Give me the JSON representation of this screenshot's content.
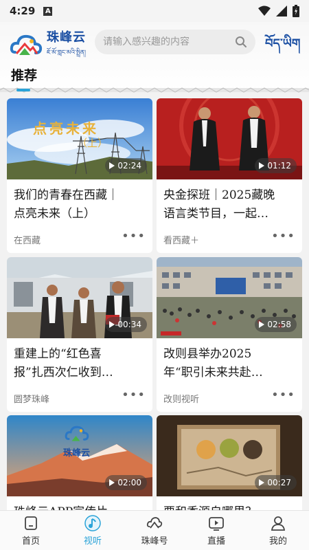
{
  "status_bar": {
    "time": "4:29",
    "badge": "A"
  },
  "header": {
    "logo_cn": "珠峰云",
    "logo_tib": "ཇོ་མོ་གླང་མའི་སྤྲིན།",
    "search_placeholder": "请输入感兴趣的内容",
    "lang_switch": "བོད་ཡིག",
    "page_title": "推荐"
  },
  "cards": [
    {
      "title_line1": "我们的青春在西藏｜",
      "title_line2": "点亮未来（上）",
      "source": "在西藏",
      "duration": "02:24",
      "overlay_text": "点亮未来",
      "overlay_sub": "（上）"
    },
    {
      "title_line1": "央金探班｜2025藏晚",
      "title_line2": "语言类节目，一起…",
      "source": "看西藏＋",
      "duration": "01:12"
    },
    {
      "title_line1": "重建上的“红色喜",
      "title_line2": "报”扎西次仁收到…",
      "source": "圆梦珠峰",
      "duration": "00:34"
    },
    {
      "title_line1": "改则县举办2025",
      "title_line2": "年“职引未来共赴…",
      "source": "改则视听",
      "duration": "02:58"
    },
    {
      "title_line1": "珠峰云APP宣传片",
      "title_line2": "",
      "source": "",
      "duration": "02:00",
      "overlay_text": "珠峰云"
    },
    {
      "title_line1": "要和香源自哪里？",
      "title_line2": "",
      "source": "",
      "duration": "00:27"
    }
  ],
  "more_glyph": "•••",
  "tabbar": [
    {
      "label": "首页",
      "icon": "home-icon",
      "active": false
    },
    {
      "label": "视听",
      "icon": "music-note-icon",
      "active": true
    },
    {
      "label": "珠峰号",
      "icon": "cloud-logo-icon",
      "active": false
    },
    {
      "label": "直播",
      "icon": "live-tv-icon",
      "active": false
    },
    {
      "label": "我的",
      "icon": "profile-icon",
      "active": false
    }
  ],
  "colors": {
    "accent": "#2aa3d8",
    "brand": "#1b4fa3"
  }
}
